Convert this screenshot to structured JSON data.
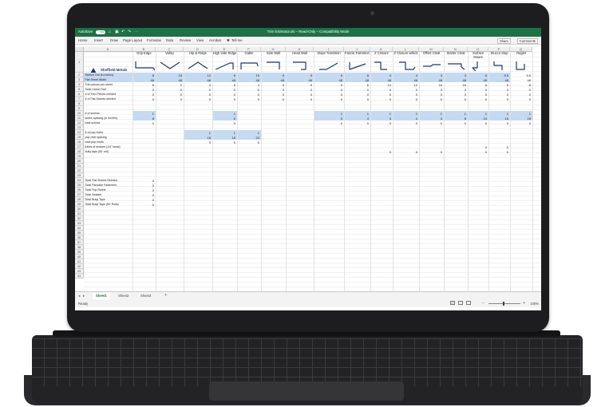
{
  "window": {
    "autosave_label": "AutoSave",
    "autosave_state": "OFF",
    "title": "Trim Estimator.xls  –  Read-Only  –  Compatibility Mode",
    "accent": "#1e7145"
  },
  "ribbon": {
    "tabs": [
      "Home",
      "Insert",
      "Draw",
      "Page Layout",
      "Formulas",
      "Data",
      "Review",
      "View",
      "Acrobat",
      "Tell me"
    ],
    "share_label": "Share",
    "comments_label": "Comments"
  },
  "columns": [
    "A",
    "B",
    "C",
    "D",
    "E",
    "F",
    "G",
    "H",
    "I",
    "J",
    "K",
    "L",
    "M",
    "N",
    "O",
    "P",
    "Q"
  ],
  "logo": {
    "name": "Sheffield Metals",
    "sub": "International",
    "tag": "Always a Partner"
  },
  "trim_names": [
    "Drip Edge",
    "Valley",
    "Hip & Ridge",
    "High Side Ridge",
    "Gable",
    "Side Wall",
    "Head Wall",
    "Slope Transition",
    "Fascia Transition",
    "Z Closure",
    "Z Closure w/kick",
    "Offset Cleat",
    "Starter Cleat",
    "Surface Mount",
    "Stucco Stop",
    "Reglet"
  ],
  "row_labels": {
    "2": "Stretch Out (in inches)",
    "3": "Flat Sheet Width",
    "4": "Trim pieces per sheet",
    "5": "Total Linear Feet",
    "6": "# of Trim Pieces needed",
    "7": "# of Flat Sheets needed",
    "8": "",
    "9": "",
    "10": "# of screws",
    "11": "screw spacing (in inches)",
    "12": "total screws",
    "13": "",
    "14": "# of pop rivets",
    "15": "pop rivet spacing",
    "16": "total pop rivets",
    "17": "tubes of sealant (1/4\" bead)",
    "18": "butly tape (50' roll)",
    "24": "Total Flat Sheets Needed",
    "25": "Total Pancake Fasteners",
    "26": "Total Pop Rivets",
    "27": "Total Sealant",
    "28": "Total Butyl Tape",
    "29": "Total Butyl Tape (50' Rolls)"
  },
  "values": {
    "2": [
      "8",
      "24",
      "12",
      "9",
      "10",
      "9",
      "9",
      "9",
      "8",
      "4",
      "4",
      "3",
      "3",
      "8",
      "8.5",
      "5.5"
    ],
    "3": [
      "48",
      "48",
      "48",
      "48",
      "48",
      "48",
      "48",
      "48",
      "48",
      "48",
      "48",
      "48",
      "48",
      "48",
      "48",
      "48"
    ],
    "4": [
      "6",
      "2",
      "4",
      "5",
      "4",
      "5",
      "5",
      "5",
      "6",
      "12",
      "12",
      "16",
      "16",
      "6",
      "5",
      "8"
    ],
    "5": [
      "0",
      "0",
      "0",
      "0",
      "0",
      "0",
      "0",
      "0",
      "0",
      "0",
      "0",
      "0",
      "0",
      "0",
      "0",
      "0"
    ],
    "6": [
      "0",
      "0",
      "0",
      "0",
      "0",
      "0",
      "0",
      "0",
      "0",
      "0",
      "0",
      "0",
      "0",
      "0",
      "0",
      "0"
    ],
    "7": [
      "0",
      "0",
      "0",
      "0",
      "0",
      "0",
      "0",
      "0",
      "0",
      "0",
      "0",
      "0",
      "0",
      "0",
      "0",
      "0"
    ],
    "10": [
      "1",
      "",
      "",
      "1",
      "",
      "",
      "",
      "1",
      "1",
      "1",
      "1",
      "1",
      "1",
      "1",
      "1",
      "1"
    ],
    "11": [
      "6",
      "",
      "",
      "6",
      "",
      "",
      "",
      "5",
      "4",
      "4",
      "4",
      "4",
      "8",
      "24",
      "16",
      "16"
    ],
    "12": [
      "0",
      "",
      "",
      "0",
      "",
      "",
      "",
      "0",
      "0",
      "0",
      "0",
      "0",
      "0",
      "0",
      "0",
      "0"
    ],
    "14": [
      "",
      "",
      "1",
      "1",
      "1",
      "",
      "",
      "",
      "",
      "",
      "",
      "",
      "",
      "",
      "",
      ""
    ],
    "15": [
      "",
      "",
      "18",
      "18",
      "24",
      "",
      "",
      "",
      "",
      "",
      "",
      "",
      "",
      "",
      "",
      ""
    ],
    "16": [
      "",
      "",
      "0",
      "0",
      "0",
      "",
      "",
      "",
      "",
      "",
      "",
      "",
      "",
      "",
      "",
      ""
    ],
    "17": [
      "",
      "",
      "",
      "",
      "",
      "",
      "",
      "",
      "",
      "",
      "",
      "",
      "",
      "0",
      "0",
      ""
    ],
    "18": [
      "",
      "",
      "",
      "",
      "",
      "",
      "",
      "",
      "",
      "0",
      "0",
      "0",
      "",
      "0",
      "0",
      ""
    ],
    "24": [
      "0",
      "",
      "",
      "",
      "",
      "",
      "",
      "",
      "",
      "",
      "",
      "",
      "",
      "",
      "",
      ""
    ],
    "25": [
      "0",
      "",
      "",
      "",
      "",
      "",
      "",
      "",
      "",
      "",
      "",
      "",
      "",
      "",
      "",
      ""
    ],
    "26": [
      "0",
      "",
      "",
      "",
      "",
      "",
      "",
      "",
      "",
      "",
      "",
      "",
      "",
      "",
      "",
      ""
    ],
    "27": [
      "0",
      "",
      "",
      "",
      "",
      "",
      "",
      "",
      "",
      "",
      "",
      "",
      "",
      "",
      "",
      ""
    ],
    "28": [
      "0",
      "",
      "",
      "",
      "",
      "",
      "",
      "",
      "",
      "",
      "",
      "",
      "",
      "",
      "",
      ""
    ],
    "29": [
      "0",
      "",
      "",
      "",
      "",
      "",
      "",
      "",
      "",
      "",
      "",
      "",
      "",
      "",
      "",
      ""
    ]
  },
  "sheets": [
    "Sheet1",
    "Sheet2",
    "Sheet3"
  ],
  "active_sheet": "Sheet1",
  "add_sheet": "+",
  "status": {
    "ready": "Ready",
    "zoom": "100%",
    "zoom_minus": "–",
    "zoom_plus": "+"
  },
  "row_highlight_color": "#c5d9f1"
}
